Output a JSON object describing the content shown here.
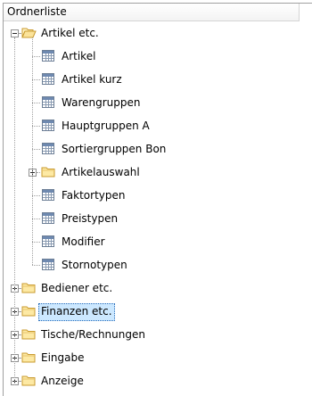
{
  "panel": {
    "title": "Ordnerliste"
  },
  "tree": [
    {
      "label": "Artikel etc.",
      "type": "folder",
      "expanded": true,
      "children": [
        {
          "label": "Artikel",
          "type": "table"
        },
        {
          "label": "Artikel kurz",
          "type": "table"
        },
        {
          "label": "Warengruppen",
          "type": "table"
        },
        {
          "label": "Hauptgruppen A",
          "type": "table"
        },
        {
          "label": "Sortiergruppen Bon",
          "type": "table"
        },
        {
          "label": "Artikelauswahl",
          "type": "folder",
          "expanded": false
        },
        {
          "label": "Faktortypen",
          "type": "table"
        },
        {
          "label": "Preistypen",
          "type": "table"
        },
        {
          "label": "Modifier",
          "type": "table"
        },
        {
          "label": "Stornotypen",
          "type": "table"
        }
      ]
    },
    {
      "label": "Bediener etc.",
      "type": "folder",
      "expanded": false
    },
    {
      "label": "Finanzen etc.",
      "type": "folder",
      "expanded": false,
      "selected": true
    },
    {
      "label": "Tische/Rechnungen",
      "type": "folder",
      "expanded": false
    },
    {
      "label": "Eingabe",
      "type": "folder",
      "expanded": false
    },
    {
      "label": "Anzeige",
      "type": "folder",
      "expanded": false
    }
  ]
}
